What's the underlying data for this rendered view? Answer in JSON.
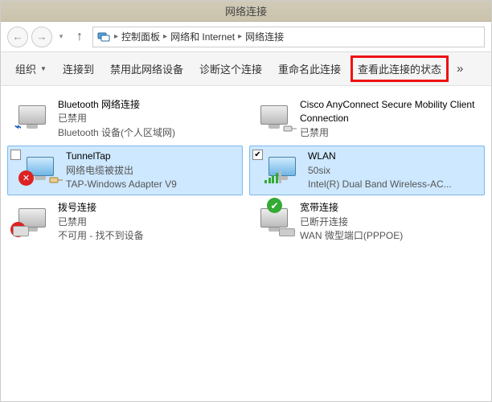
{
  "title": "网络连接",
  "breadcrumb": {
    "seg1": "控制面板",
    "seg2": "网络和 Internet",
    "seg3": "网络连接"
  },
  "toolbar": {
    "organize": "组织",
    "connectTo": "连接到",
    "disable": "禁用此网络设备",
    "diagnose": "诊断这个连接",
    "rename": "重命名此连接",
    "viewStatus": "查看此连接的状态"
  },
  "items": [
    {
      "name": "Bluetooth 网络连接",
      "status": "已禁用",
      "device": "Bluetooth 设备(个人区域网)"
    },
    {
      "name": "Cisco AnyConnect Secure Mobility Client Connection",
      "status": "已禁用",
      "device": ""
    },
    {
      "name": "TunnelTap",
      "status": "网络电缆被拔出",
      "device": "TAP-Windows Adapter V9"
    },
    {
      "name": "WLAN",
      "status": "50six",
      "device": "Intel(R) Dual Band Wireless-AC..."
    },
    {
      "name": "拨号连接",
      "status": "已禁用",
      "device": "不可用 - 找不到设备"
    },
    {
      "name": "宽带连接",
      "status": "已断开连接",
      "device": "WAN 微型端口(PPPOE)"
    }
  ]
}
